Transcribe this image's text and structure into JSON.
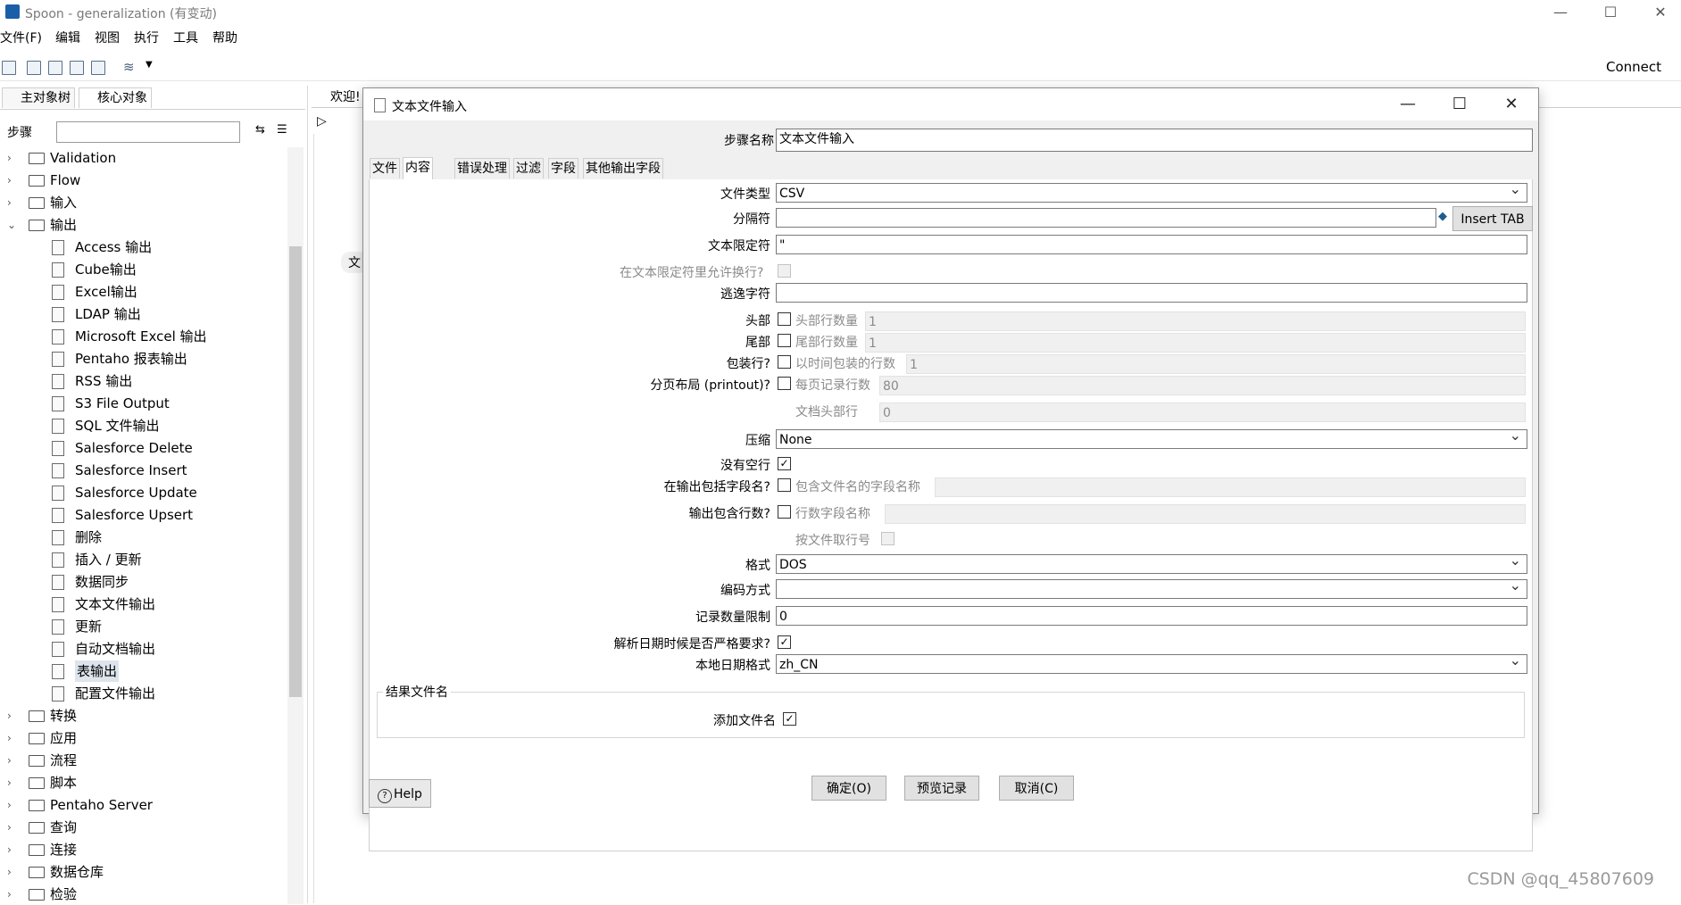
{
  "window": {
    "title": "Spoon - generalization (有变动)"
  },
  "menu": [
    "文件(F)",
    "编辑",
    "视图",
    "执行",
    "工具",
    "帮助"
  ],
  "toolbar": {
    "connect": "Connect"
  },
  "left_panel": {
    "tabs": [
      "主对象树",
      "核心对象"
    ],
    "steps_label": "步骤",
    "search_value": "",
    "tree": [
      {
        "label": "Validation",
        "kind": "folder",
        "expanded": false
      },
      {
        "label": "Flow",
        "kind": "folder",
        "expanded": false
      },
      {
        "label": "输入",
        "kind": "folder",
        "expanded": false
      },
      {
        "label": "输出",
        "kind": "folder",
        "expanded": true
      },
      {
        "label": "Access 输出",
        "kind": "leaf"
      },
      {
        "label": "Cube输出",
        "kind": "leaf"
      },
      {
        "label": "Excel输出",
        "kind": "leaf"
      },
      {
        "label": "LDAP 输出",
        "kind": "leaf"
      },
      {
        "label": "Microsoft Excel 输出",
        "kind": "leaf"
      },
      {
        "label": "Pentaho 报表输出",
        "kind": "leaf"
      },
      {
        "label": "RSS 输出",
        "kind": "leaf"
      },
      {
        "label": "S3 File Output",
        "kind": "leaf"
      },
      {
        "label": "SQL 文件输出",
        "kind": "leaf"
      },
      {
        "label": "Salesforce Delete",
        "kind": "leaf"
      },
      {
        "label": "Salesforce Insert",
        "kind": "leaf"
      },
      {
        "label": "Salesforce Update",
        "kind": "leaf"
      },
      {
        "label": "Salesforce Upsert",
        "kind": "leaf"
      },
      {
        "label": "删除",
        "kind": "leaf"
      },
      {
        "label": "插入 / 更新",
        "kind": "leaf"
      },
      {
        "label": "数据同步",
        "kind": "leaf"
      },
      {
        "label": "文本文件输出",
        "kind": "leaf"
      },
      {
        "label": "更新",
        "kind": "leaf"
      },
      {
        "label": "自动文档输出",
        "kind": "leaf"
      },
      {
        "label": "表输出",
        "kind": "leaf",
        "selected": true
      },
      {
        "label": "配置文件输出",
        "kind": "leaf"
      },
      {
        "label": "转换",
        "kind": "folder",
        "expanded": false
      },
      {
        "label": "应用",
        "kind": "folder",
        "expanded": false
      },
      {
        "label": "流程",
        "kind": "folder",
        "expanded": false
      },
      {
        "label": "脚本",
        "kind": "folder",
        "expanded": false
      },
      {
        "label": "Pentaho Server",
        "kind": "folder",
        "expanded": false
      },
      {
        "label": "查询",
        "kind": "folder",
        "expanded": false
      },
      {
        "label": "连接",
        "kind": "folder",
        "expanded": false
      },
      {
        "label": "数据仓库",
        "kind": "folder",
        "expanded": false
      },
      {
        "label": "检验",
        "kind": "folder",
        "expanded": false
      }
    ]
  },
  "canvas": {
    "tab_label": "欢迎!",
    "node_partial": "文",
    "watermark": "CSDN @qq_45807609"
  },
  "dialog": {
    "title": "文本文件输入",
    "step_name_label": "步骤名称",
    "step_name_value": "文本文件输入",
    "tabs": [
      "文件",
      "内容",
      "错误处理",
      "过滤",
      "字段",
      "其他输出字段"
    ],
    "active_tab": "内容",
    "fields": {
      "file_type_label": "文件类型",
      "file_type_value": "CSV",
      "separator_label": "分隔符",
      "separator_value": "",
      "insert_tab": "Insert TAB",
      "enclosure_label": "文本限定符",
      "enclosure_value": "\"",
      "allow_breaks_label": "在文本限定符里允许换行?",
      "escape_label": "逃逸字符",
      "escape_value": "",
      "header_label": "头部",
      "header_lines_label": "头部行数量",
      "header_lines_value": "1",
      "footer_label": "尾部",
      "footer_lines_label": "尾部行数量",
      "footer_lines_value": "1",
      "wrapped_label": "包装行?",
      "wrapped_lines_label": "以时间包装的行数",
      "wrapped_lines_value": "1",
      "paged_label": "分页布局 (printout)?",
      "page_rows_label": "每页记录行数",
      "page_rows_value": "80",
      "doc_header_label": "文档头部行",
      "doc_header_value": "0",
      "compression_label": "压缩",
      "compression_value": "None",
      "no_empty_label": "没有空行",
      "no_empty_checked": true,
      "include_filename_label": "在输出包括字段名?",
      "include_filename_field_label": "包含文件名的字段名称",
      "rownum_label": "输出包含行数?",
      "rownum_field_label": "行数字段名称",
      "rownum_by_file_label": "按文件取行号",
      "format_label": "格式",
      "format_value": "DOS",
      "encoding_label": "编码方式",
      "encoding_value": "",
      "limit_label": "记录数量限制",
      "limit_value": "0",
      "lenient_date_label": "解析日期时候是否严格要求?",
      "lenient_date_checked": true,
      "locale_label": "本地日期格式",
      "locale_value": "zh_CN"
    },
    "result_group": {
      "title": "结果文件名",
      "add_filename_label": "添加文件名",
      "add_filename_checked": true
    },
    "buttons": {
      "ok": "确定(O)",
      "preview": "预览记录",
      "cancel": "取消(C)",
      "help": "Help"
    }
  }
}
